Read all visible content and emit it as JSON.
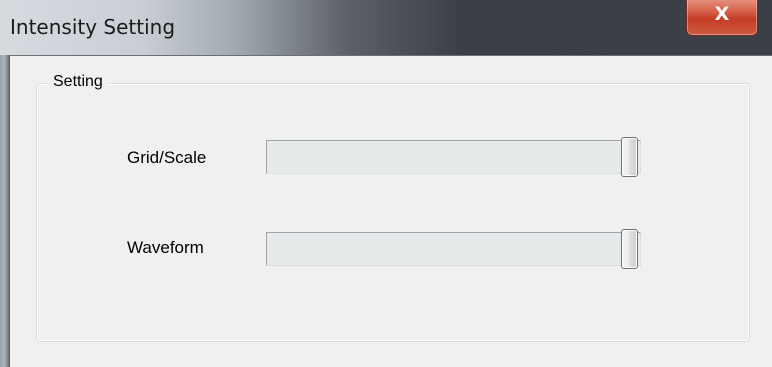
{
  "window": {
    "title": "Intensity Setting",
    "close_glyph": "X"
  },
  "group": {
    "legend": "Setting"
  },
  "sliders": [
    {
      "label": "Grid/Scale",
      "level_percent": 100
    },
    {
      "label": "Waveform",
      "level_percent": 100
    }
  ],
  "colors": {
    "client_bg": "#f0f0f0",
    "close_button": "#c7462d"
  },
  "icons": {
    "close": "close-icon"
  }
}
